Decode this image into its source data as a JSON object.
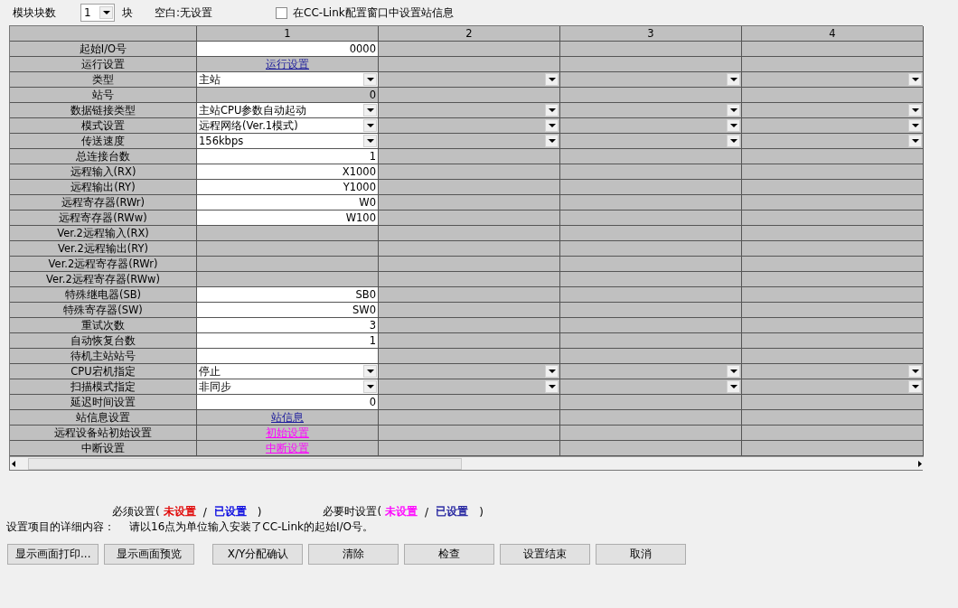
{
  "top_bar": {
    "module_count_label": "模块块数",
    "module_count": "1",
    "unit": "块",
    "blank_note": "空白:无设置",
    "station_info_checkbox": {
      "label": "在CC-Link配置窗口中设置站信息",
      "checked": false
    }
  },
  "table": {
    "columns": [
      "1",
      "2",
      "3",
      "4"
    ],
    "rows": [
      {
        "label": "起始I/O号",
        "kind": "input",
        "value": "0000"
      },
      {
        "label": "运行设置",
        "kind": "link",
        "value": "运行设置",
        "color": "#1a1a9c"
      },
      {
        "label": "类型",
        "kind": "select",
        "value": "主站"
      },
      {
        "label": "站号",
        "kind": "readonly",
        "value": "0"
      },
      {
        "label": "数据链接类型",
        "kind": "select",
        "value": "主站CPU参数自动起动"
      },
      {
        "label": "模式设置",
        "kind": "select",
        "value": "远程网络(Ver.1模式)"
      },
      {
        "label": "传送速度",
        "kind": "select",
        "value": "156kbps"
      },
      {
        "label": "总连接台数",
        "kind": "input",
        "value": "1"
      },
      {
        "label": "远程输入(RX)",
        "kind": "input",
        "value": "X1000"
      },
      {
        "label": "远程输出(RY)",
        "kind": "input",
        "value": "Y1000"
      },
      {
        "label": "远程寄存器(RWr)",
        "kind": "input",
        "value": "W0"
      },
      {
        "label": "远程寄存器(RWw)",
        "kind": "input",
        "value": "W100"
      },
      {
        "label": "Ver.2远程输入(RX)",
        "kind": "readonly"
      },
      {
        "label": "Ver.2远程输出(RY)",
        "kind": "readonly"
      },
      {
        "label": "Ver.2远程寄存器(RWr)",
        "kind": "readonly"
      },
      {
        "label": "Ver.2远程寄存器(RWw)",
        "kind": "readonly"
      },
      {
        "label": "特殊继电器(SB)",
        "kind": "input",
        "value": "SB0"
      },
      {
        "label": "特殊寄存器(SW)",
        "kind": "input",
        "value": "SW0"
      },
      {
        "label": "重试次数",
        "kind": "input",
        "value": "3"
      },
      {
        "label": "自动恢复台数",
        "kind": "input",
        "value": "1"
      },
      {
        "label": "待机主站站号",
        "kind": "input"
      },
      {
        "label": "CPU宕机指定",
        "kind": "select",
        "value": "停止"
      },
      {
        "label": "扫描模式指定",
        "kind": "select",
        "value": "非同步"
      },
      {
        "label": "延迟时间设置",
        "kind": "input",
        "value": "0"
      },
      {
        "label": "站信息设置",
        "kind": "link",
        "value": "站信息",
        "color": "#1a1a9c"
      },
      {
        "label": "远程设备站初始设置",
        "kind": "link",
        "value": "初始设置",
        "color": "#ff00ff"
      },
      {
        "label": "中断设置",
        "kind": "link",
        "value": "中断设置",
        "color": "#ff00ff"
      }
    ]
  },
  "legend": [
    {
      "label": "必须设置(",
      "items": [
        {
          "text": "未设置",
          "color": "#e00000"
        },
        {
          "text": "已设置",
          "color": "#0000e0"
        }
      ],
      "separator": "/",
      "close": ")"
    },
    {
      "label": "必要时设置(",
      "items": [
        {
          "text": "未设置",
          "color": "#ff00ff"
        },
        {
          "text": "已设置",
          "color": "#1a1a9c"
        }
      ],
      "separator": "/",
      "close": ")"
    }
  ],
  "details": {
    "label": "设置项目的详细内容：",
    "text": "请以16点为单位输入安装了CC-Link的起始I/O号。"
  },
  "buttons": [
    "显示画面打印...",
    "显示画面预览",
    "X/Y分配确认",
    "清除",
    "检查",
    "设置结束",
    "取消"
  ]
}
